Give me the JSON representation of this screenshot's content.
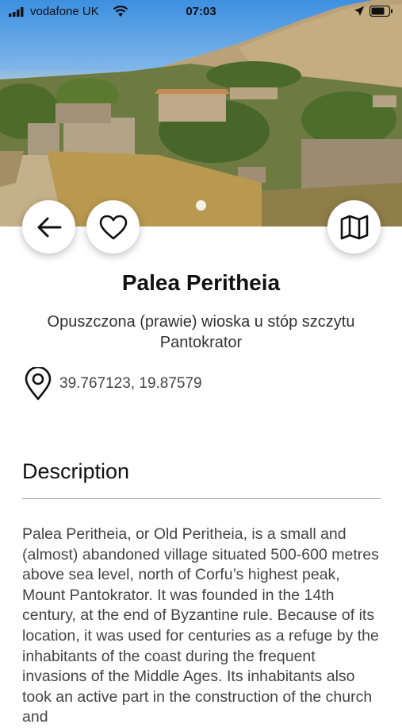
{
  "status_bar": {
    "carrier": "vodafone UK",
    "time": "07:03"
  },
  "place": {
    "title": "Palea Peritheia",
    "subtitle": "Opuszczona (prawie) wioska u stóp szczytu Pantokrator",
    "coordinates": "39.767123, 19.87579"
  },
  "description": {
    "heading": "Description",
    "body": "Palea Peritheia, or Old Peritheia, is a small and (almost) abandoned village situated 500-600 metres above sea level, north of Corfu’s highest peak, Mount Pantokrator. It was founded in the 14th century, at the end of Byzantine rule. Because of its location, it was used for centuries as a refuge by the inhabitants of the coast during the frequent invasions of the Middle Ages. Its inhabitants also took an active part in the construction of the church and"
  },
  "icons": {
    "back": "arrow-left-icon",
    "favorite": "heart-icon",
    "map": "map-icon",
    "location": "location-pin-icon"
  },
  "colors": {
    "sky": "#3d8fe0",
    "background": "#ffffff",
    "text_primary": "#111111",
    "text_secondary": "#444444"
  }
}
